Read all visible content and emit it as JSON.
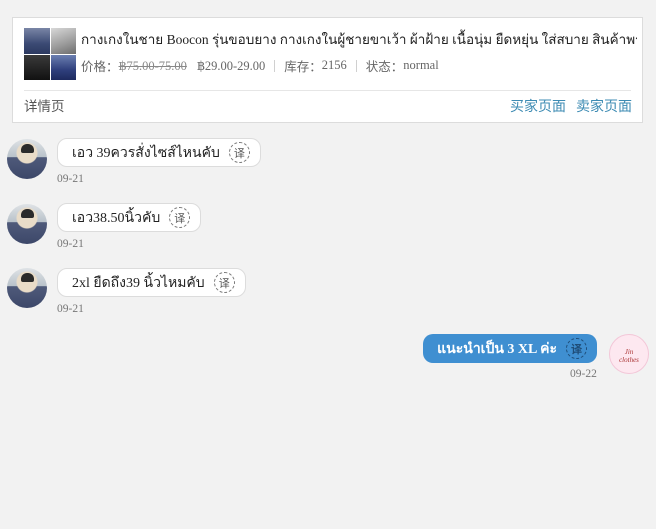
{
  "product": {
    "title": "กางเกงในชาย Boocon รุ่นขอบยาง กางเกงในผู้ชายขาเว้า ผ้าฝ้าย เนื้อนุ่ม ยืดหยุ่น ใส่สบาย สินค้าพร้อมส่ง",
    "price_label": "价格：",
    "original_price": "฿75.00-75.00",
    "sale_price": "฿29.00-29.00",
    "stock_label": "库存：",
    "stock_value": "2156",
    "status_label": "状态：",
    "status_value": "normal",
    "detail_link": "详情页",
    "buyer_page_link": "买家页面",
    "seller_page_link": "卖家页面"
  },
  "messages": [
    {
      "sender": "buyer",
      "text": "เอว 39ควรสั่งไซส์ไหนคับ",
      "time": "09-21",
      "translate_icon": "译"
    },
    {
      "sender": "buyer",
      "text": "เอว38.50นิ้วคับ",
      "time": "09-21",
      "translate_icon": "译"
    },
    {
      "sender": "buyer",
      "text": "2xl ยืดถึง39 นิ้วไหมคับ",
      "time": "09-21",
      "translate_icon": "译"
    },
    {
      "sender": "seller",
      "text": "แนะนำเป็น 3 XL ค่ะ",
      "time": "09-22",
      "translate_icon": "译"
    }
  ],
  "seller_avatar_text": "Jin\nclothes",
  "colors": {
    "accent": "#3f8fd1",
    "link": "#3d8bb3",
    "background": "#f2f2f2"
  }
}
